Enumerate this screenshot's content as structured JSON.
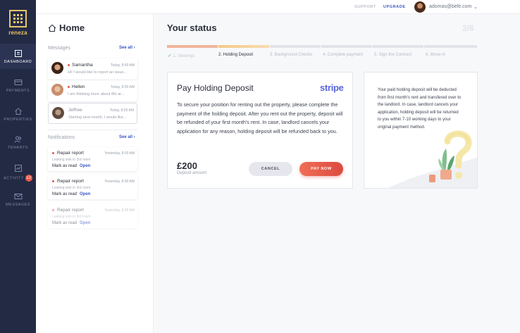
{
  "brand": {
    "name": "reneza",
    "color": "#e9c46a"
  },
  "nav": {
    "items": [
      {
        "label": "DASHBOARD",
        "icon": "dashboard-icon"
      },
      {
        "label": "PAYMENTS",
        "icon": "payments-icon"
      },
      {
        "label": "PROPERTIES",
        "icon": "home-icon"
      },
      {
        "label": "TENANTS",
        "icon": "tenants-icon"
      },
      {
        "label": "ACTIVITY",
        "icon": "activity-icon",
        "badge": "12"
      },
      {
        "label": "MESSAGES",
        "icon": "mail-icon"
      }
    ]
  },
  "topbar": {
    "support": "SUPPORT",
    "upgrade": "UPGRADE",
    "email": "adomas@beltr.com"
  },
  "left": {
    "title": "Home",
    "messages_head": "Messages",
    "see_all": "See all",
    "messages": [
      {
        "name": "Samantha",
        "time": "Today, 8:00 AM",
        "preview": "Hi! I would like to report an issue..."
      },
      {
        "name": "Hellen",
        "time": "Today, 8:00 AM",
        "preview": "I am thinking more about 8th ar..."
      },
      {
        "name": "Jeffree",
        "time": "Today, 8:00 AM",
        "preview": "Starting next month, I would like..."
      }
    ],
    "notifications_head": "Notifications",
    "notifications": [
      {
        "title": "Repair report",
        "time": "Yesterday, 8:00 AM",
        "sub": "Leaking sink in 3rd room",
        "mark": "Mark as read",
        "open": "Open"
      },
      {
        "title": "Repair report",
        "time": "Yesterday, 8:00 AM",
        "sub": "Leaking sink in 3rd room",
        "mark": "Mark as read",
        "open": "Open"
      },
      {
        "title": "Repair report",
        "time": "Yesterday, 8:00 AM",
        "sub": "Leaking sink in 3rd room",
        "mark": "Mark as read",
        "open": "Open"
      }
    ]
  },
  "status": {
    "title": "Your status",
    "step_count": "2/6",
    "steps": [
      "1. Viewings",
      "2. Holding Deposit",
      "3. Background Checks",
      "4. Complete payment",
      "5. Sign the Contract",
      "6. Move-in"
    ]
  },
  "card": {
    "title": "Pay Holding Deposit",
    "provider": "stripe",
    "description": "To secure your position for renting out the property, please complete the payment of the holding deposit. After you rent out the property, deposit will be refunded of your first month's rent. In case, landlord cancels your application for any reason, holding deposit will be refunded back to you.",
    "amount": "£200",
    "amount_label": "Deposit amount",
    "cancel_label": "CANCEL",
    "pay_label": "PAY NOW"
  },
  "info": {
    "text": "Your paid holding deposit will be deducted from first month's rent and transfered over to the landlord. In case, landlord cancels your application, holding deposit will be returned to you within 7-10 working days to your original payment method."
  },
  "colors": {
    "nav_bg": "#222a44",
    "accent": "#3a56c4",
    "pay": "#e4594b",
    "progress": "#f3c98a"
  }
}
